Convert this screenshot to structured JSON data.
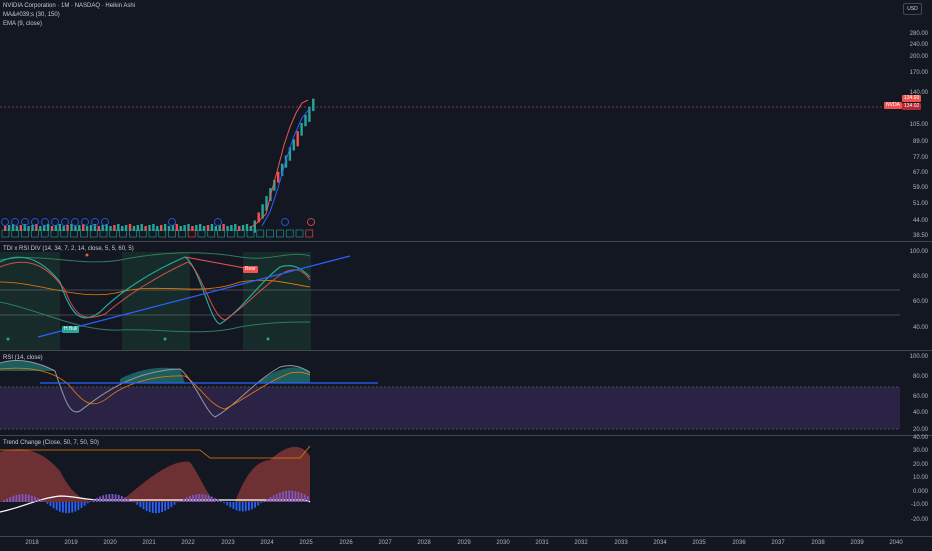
{
  "header": {
    "title": "NVIDIA Corporation · 1M · NASDAQ · Heikin Ashi",
    "ind1": "MA&#039;s (30, 150)",
    "ind2": "EMA (9, close)",
    "currency": "USD"
  },
  "price_axis": [
    "280.00",
    "240.00",
    "200.00",
    "170.00",
    "140.00",
    "123.00",
    "105.00",
    "89.00",
    "77.00",
    "67.00",
    "59.00",
    "51.00",
    "44.00",
    "38.50"
  ],
  "price_tags": {
    "symbol": "NVDA",
    "price1": "134.93",
    "price2": "134.02"
  },
  "tdi": {
    "label": "TDI x RSI DIV (14, 34, 7, 2, 14, close, 5, 5, 60, 5)",
    "axis": [
      "100.00",
      "80.00",
      "60.00",
      "40.00"
    ],
    "bull_label": "H Bull",
    "bear_label": "Bear"
  },
  "rsi": {
    "label": "RSI (14, close)",
    "axis": [
      "100.00",
      "80.00",
      "60.00",
      "40.00",
      "20.00"
    ]
  },
  "trend": {
    "label": "Trend Change (Close, 50, 7, 50, 50)",
    "axis": [
      "40.00",
      "30.00",
      "20.00",
      "10.00",
      "0.000",
      "-10.00",
      "-20.00"
    ]
  },
  "time_axis": [
    "2018",
    "2019",
    "2020",
    "2021",
    "2022",
    "2023",
    "2024",
    "2025",
    "2026",
    "2027",
    "2028",
    "2029",
    "2030",
    "2031",
    "2032",
    "2033",
    "2034",
    "2035",
    "2036",
    "2037",
    "2038",
    "2039",
    "2040"
  ],
  "colors": {
    "up": "#26a69a",
    "down": "#ef5350",
    "blue": "#2962ff",
    "orange": "#f57c00",
    "bg": "#131722"
  }
}
